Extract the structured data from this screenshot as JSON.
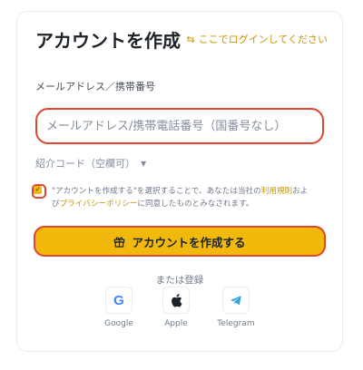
{
  "header": {
    "title": "アカウントを作成",
    "login_link": "ここでログインしてください",
    "login_icon": "swap-arrows-icon"
  },
  "form": {
    "field_label": "メールアドレス／携帯番号",
    "input_placeholder": "メールアドレス/携帯電話番号（国番号なし）",
    "input_value": "",
    "referral_label": "紹介コード（空欄可）"
  },
  "agreement": {
    "checked": true,
    "text_part1": "\"アカウントを作成する\"を選択することで、あなたは当社の",
    "terms_link": "利用規則",
    "text_part2": "およ",
    "text_part3": "び",
    "privacy_link": "プライバシーポリシー",
    "text_part4": "に同意したものとみなされます。"
  },
  "create_button": {
    "label": "アカウントを作成する",
    "icon": "gift-icon"
  },
  "alt_login": {
    "divider_text": "または登録",
    "providers": [
      {
        "label": "Google",
        "icon": "google-icon"
      },
      {
        "label": "Apple",
        "icon": "apple-icon"
      },
      {
        "label": "Telegram",
        "icon": "telegram-icon"
      }
    ]
  },
  "colors": {
    "accent": "#f0b90b",
    "link": "#c99400",
    "highlight": "#e0452e",
    "text": "#1e2329",
    "muted": "#848e9c"
  }
}
